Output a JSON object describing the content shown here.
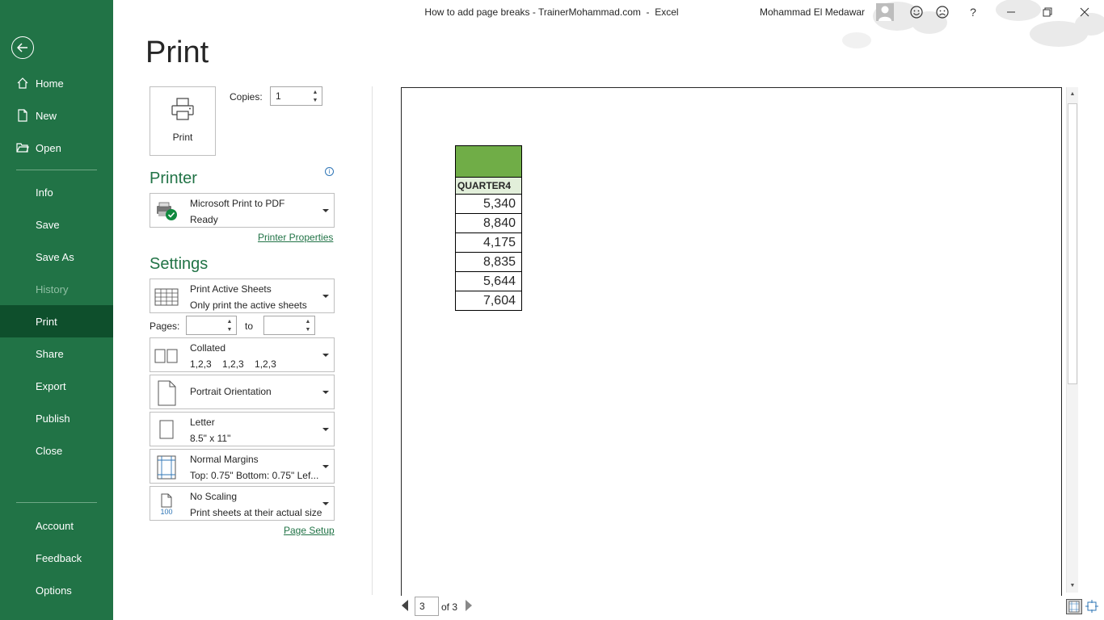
{
  "window": {
    "document_title": "How to add page breaks - TrainerMohammad.com",
    "app_name": "Excel",
    "separator": "  -  ",
    "user_name": "Mohammad El Medawar"
  },
  "sidebar": {
    "back_icon": "back-arrow-icon",
    "items": [
      {
        "label": "Home",
        "icon": "home-icon"
      },
      {
        "label": "New",
        "icon": "new-document-icon"
      },
      {
        "label": "Open",
        "icon": "open-folder-icon"
      },
      {
        "label": "Info"
      },
      {
        "label": "Save"
      },
      {
        "label": "Save As"
      },
      {
        "label": "History",
        "state": "disabled"
      },
      {
        "label": "Print",
        "state": "selected"
      },
      {
        "label": "Share"
      },
      {
        "label": "Export"
      },
      {
        "label": "Publish"
      },
      {
        "label": "Close"
      },
      {
        "label": "Account"
      },
      {
        "label": "Feedback"
      },
      {
        "label": "Options"
      }
    ]
  },
  "print_panel": {
    "title": "Print",
    "print_button_label": "Print",
    "copies_label": "Copies:",
    "copies_value": "1",
    "printer_heading": "Printer",
    "printer": {
      "name": "Microsoft Print to PDF",
      "status": "Ready"
    },
    "printer_properties_link": "Printer Properties",
    "settings_heading": "Settings",
    "print_what": {
      "main": "Print Active Sheets",
      "sub": "Only print the active sheets"
    },
    "pages_label": "Pages:",
    "pages_from": "",
    "to_label": "to",
    "pages_to": "",
    "collation": {
      "main": "Collated",
      "sub": "1,2,3    1,2,3    1,2,3"
    },
    "orientation": {
      "main": "Portrait Orientation"
    },
    "paper": {
      "main": "Letter",
      "sub": "8.5\" x 11\""
    },
    "margins": {
      "main": "Normal Margins",
      "sub": "Top: 0.75\" Bottom: 0.75\" Lef..."
    },
    "scaling": {
      "main": "No Scaling",
      "sub": "Print sheets at their actual size",
      "icon_text": "100"
    },
    "page_setup_link": "Page Setup"
  },
  "preview": {
    "header": "QUARTER4",
    "values": [
      "5,340",
      "8,840",
      "4,175",
      "8,835",
      "5,644",
      "7,604"
    ],
    "current_page": "3",
    "page_of": "of 3",
    "header_fill": "#70ad47"
  },
  "colors": {
    "accent": "#217346",
    "sidebar_active": "#0e4f2c"
  }
}
